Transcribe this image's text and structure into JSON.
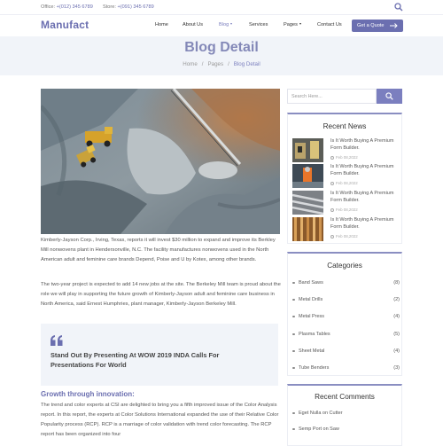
{
  "topbar": {
    "office_label": "Office:",
    "office_phone": "+(012) 345 6789",
    "store_label": "Store:",
    "store_phone": "+(091) 345 6789"
  },
  "nav": {
    "logo": "Manufact",
    "items": [
      {
        "label": "Home"
      },
      {
        "label": "About Us"
      },
      {
        "label": "Blog"
      },
      {
        "label": "Services"
      },
      {
        "label": "Pages"
      },
      {
        "label": "Contact Us"
      }
    ],
    "cta_label": "Get a Quote"
  },
  "hero": {
    "title": "Blog Detail",
    "breadcrumb": [
      "Home",
      "Pages",
      "Blog Detail"
    ]
  },
  "article": {
    "paragraph1": "Kimberly-Jayson Corp., Irving, Texas, reports it will invest $30 million to expand and improve its Berkley Mill nonwovens plant in Hendersonville, N.C. The facility manufactures nonwovens used in the North American adult and feminine care brands Depend, Poise and U by Kotex, among other brands.",
    "paragraph2": "The two-year project is expected to add 14 new jobs at the site. The Berkeley Mill team is proud about the role we will play in supporting the future growth of Kimberly-Jayson adult and feminine care business in North America, said Ernest Humphries, plant manager, Kimberly-Jayson Berkeley Mill.",
    "quote": "Stand Out By Presenting At WOW 2019 INDA Calls For Presentations For World",
    "subheading": "Growth through innovation:",
    "paragraph3": "The trend and color experts at CSI are delighted to bring you a fifth improved issue of the Color Analysis report. In this report, the experts at Color Solutions International expanded the use of their Relative Color Popularity process (RCP). RCP is a marriage of color validation with trend color forecasting. The RCP report has been organized into four"
  },
  "sidebar": {
    "search_placeholder": "Search Here...",
    "recent_news_title": "Recent News",
    "recent_news": [
      {
        "title": "Is It Worth Buying A Premium Form Builder.",
        "date": "Feb 08,2022"
      },
      {
        "title": "Is It Worth Buying A Premium Form Builder.",
        "date": "Feb 08,2022"
      },
      {
        "title": "Is It Worth Buying A Premium Form Builder.",
        "date": "Feb 08,2022"
      },
      {
        "title": "Is It Worth Buying A Premium Form Builder.",
        "date": "Feb 08,2022"
      }
    ],
    "categories_title": "Categories",
    "categories": [
      {
        "name": "Band Saws",
        "count": "(8)"
      },
      {
        "name": "Metal Drills",
        "count": "(2)"
      },
      {
        "name": "Metal Press",
        "count": "(4)"
      },
      {
        "name": "Plasma Tables",
        "count": "(5)"
      },
      {
        "name": "Sheet Metal",
        "count": "(4)"
      },
      {
        "name": "Tube Benders",
        "count": "(3)"
      }
    ],
    "comments_title": "Recent Comments",
    "comments": [
      {
        "text": "Eget Nulla on Cutter"
      },
      {
        "text": "Semp Port on Saw"
      }
    ]
  },
  "colors": {
    "accent": "#6b6fb0",
    "hero_bg": "#f1f4f9"
  }
}
